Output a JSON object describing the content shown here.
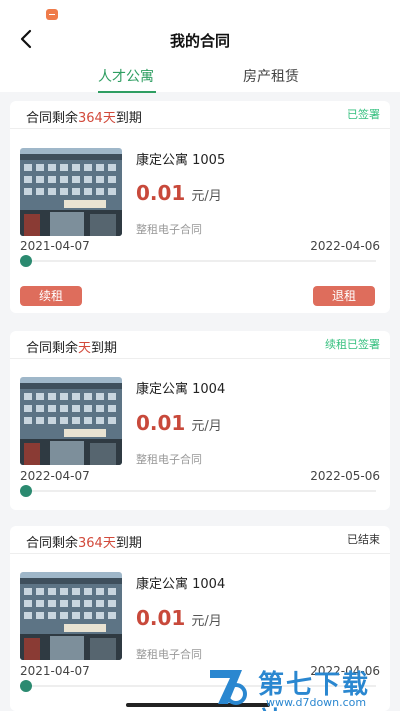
{
  "header": {
    "title": "我的合同"
  },
  "tabs": [
    {
      "label": "人才公寓",
      "active": true
    },
    {
      "label": "房产租赁",
      "active": false
    }
  ],
  "contracts": [
    {
      "remain_prefix": "合同剩余",
      "remain_days": "364天",
      "remain_suffix": "到期",
      "status": "已签署",
      "apartment": "康定公寓 1005",
      "price": "0.01",
      "unit": "元/月",
      "contract_type": "整租电子合同",
      "start_date": "2021-04-07",
      "end_date": "2022-04-06",
      "renew_label": "续租",
      "checkout_label": "退租"
    },
    {
      "remain_prefix": "合同剩余",
      "remain_days": "天",
      "remain_suffix": "到期",
      "status": "续租已签署",
      "apartment": "康定公寓 1004",
      "price": "0.01",
      "unit": "元/月",
      "contract_type": "整租电子合同",
      "start_date": "2022-04-07",
      "end_date": "2022-05-06"
    },
    {
      "remain_prefix": "合同剩余",
      "remain_days": "364天",
      "remain_suffix": "到期",
      "status": "已结束",
      "apartment": "康定公寓 1004",
      "price": "0.01",
      "unit": "元/月",
      "contract_type": "整租电子合同",
      "start_date": "2021-04-07",
      "end_date": "2022-04-06"
    }
  ],
  "watermark": {
    "text": "第七下载站",
    "url": "www.d7down.com"
  },
  "colors": {
    "accent": "#2f9e62",
    "days": "#d24a3b",
    "price": "#c8493b",
    "signed": "#35c07f",
    "button": "#de6d5c",
    "progress": "#2b8a70"
  }
}
